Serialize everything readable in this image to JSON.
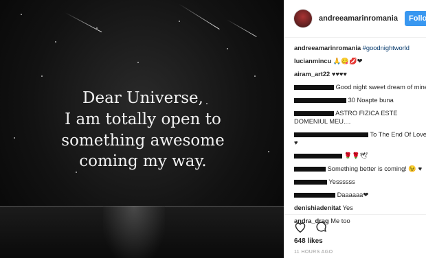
{
  "post": {
    "quote_lines": [
      "Dear Universe,",
      "I am totally open to",
      "something awesome",
      "coming my way."
    ]
  },
  "header": {
    "username": "andreeamarinromania",
    "follow_label": "Follow"
  },
  "caption": {
    "username": "andreeamarinromania",
    "hashtag": "#goodnightworld"
  },
  "comments": [
    {
      "user": "lucianmincu",
      "text": "🙏😋💋❤"
    },
    {
      "user": "airam_art22",
      "text": "♥♥♥♥"
    },
    {
      "user": "",
      "text": "Good night sweet dream of mine"
    },
    {
      "user": "",
      "text": "30 Noapte buna"
    },
    {
      "user": "",
      "text": "ASTRO FIZICA ESTE DOMENIUL MEU...."
    },
    {
      "user": "",
      "text": "To The End Of Love"
    },
    {
      "user": "",
      "text": "♥"
    },
    {
      "user": "",
      "text": "🌹🌹🕊"
    },
    {
      "user": "",
      "text": "Something better is coming! 😉 ♥"
    },
    {
      "user": "",
      "text": "Yessssss"
    },
    {
      "user": "",
      "text": "Daaaaaa❤"
    },
    {
      "user": "denishiadenitat",
      "text": "Yes"
    },
    {
      "user": "andra_drag",
      "text": "Me too"
    }
  ],
  "actions": {
    "likes": "648 likes",
    "time": "11 HOURS AGO"
  },
  "icons": {
    "like": "heart-icon",
    "comment": "comment-icon"
  }
}
